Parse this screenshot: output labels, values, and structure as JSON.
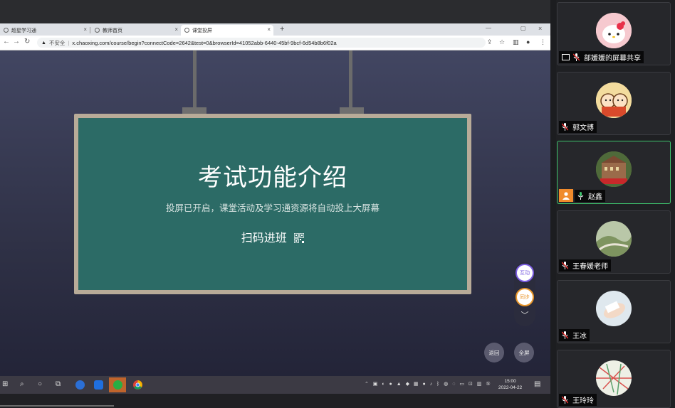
{
  "browser": {
    "tabs": [
      {
        "label": "超星学习通"
      },
      {
        "label": "教师首页"
      },
      {
        "label": "课堂投屏"
      }
    ],
    "url_insecure": "不安全",
    "url": "x.chaoxing.com/course/begin?connectCode=2642&test=0&browserId=41052abb-6440-45bf-9bcf-6d54b8b6f02a"
  },
  "board": {
    "title": "考试功能介绍",
    "subtitle": "投屏已开启，课堂活动及学习通资源将自动投上大屏幕",
    "scan": "扫码进班"
  },
  "floating": {
    "interact": "互动",
    "sync": "同步",
    "back": "返回",
    "fullscreen": "全屏"
  },
  "taskbar": {
    "time": "15:00",
    "date": "2022-04-22"
  },
  "participants": [
    {
      "name": "部媛媛的屏幕共享",
      "avatar": "hello-kitty"
    },
    {
      "name": "郭文博",
      "avatar": "cartoon-kids"
    },
    {
      "name": "赵鑫",
      "avatar": "building-photo",
      "speaking": true
    },
    {
      "name": "王春媛老师",
      "avatar": "landscape-photo"
    },
    {
      "name": "王冰",
      "avatar": "hand-photo"
    },
    {
      "name": "王玲玲",
      "avatar": "map-photo"
    }
  ],
  "colors": {
    "board": "#2c6b66",
    "speaking_border": "#3ec46d",
    "interact_accent": "#7a5ce0",
    "sync_accent": "#e8962b"
  }
}
